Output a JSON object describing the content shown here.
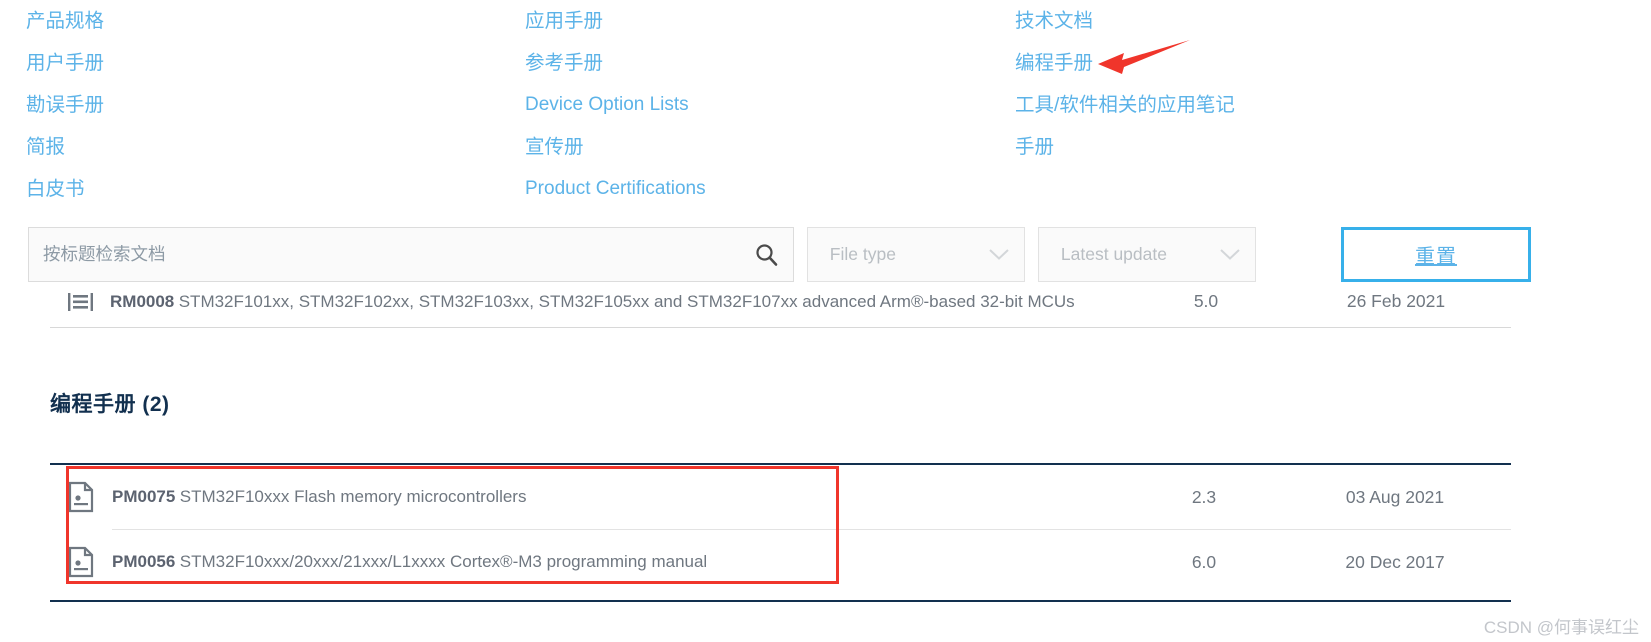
{
  "categories": {
    "column1": [
      {
        "label": "产品规格",
        "latin": false
      },
      {
        "label": "用户手册",
        "latin": false
      },
      {
        "label": "勘误手册",
        "latin": false
      },
      {
        "label": "简报",
        "latin": false
      },
      {
        "label": "白皮书",
        "latin": false
      }
    ],
    "column2": [
      {
        "label": "应用手册",
        "latin": false
      },
      {
        "label": "参考手册",
        "latin": false
      },
      {
        "label": "Device Option Lists",
        "latin": true
      },
      {
        "label": "宣传册",
        "latin": false
      },
      {
        "label": "Product Certifications",
        "latin": true
      }
    ],
    "column3": [
      {
        "label": "技术文档",
        "latin": false
      },
      {
        "label": "编程手册",
        "latin": false
      },
      {
        "label": "工具/软件相关的应用笔记",
        "latin": false
      },
      {
        "label": "手册",
        "latin": false
      }
    ]
  },
  "annotation": {
    "type": "red-arrow",
    "points_to": "编程手册",
    "color": "#f0352b"
  },
  "filter_bar": {
    "search": {
      "placeholder": "按标题检索文档",
      "value": "",
      "icon": "search-icon"
    },
    "file_type": {
      "label": "File type",
      "icon": "chevron-down-icon"
    },
    "latest_update": {
      "label": "Latest update",
      "icon": "chevron-down-icon"
    },
    "reset": {
      "label": "重置",
      "border_color": "#37b0ea",
      "text_color": "#5cb3e8"
    }
  },
  "clipped_row": {
    "id": "RM0008",
    "description": "STM32F101xx, STM32F102xx, STM32F103xx, STM32F105xx and STM32F107xx advanced Arm®-based 32-bit MCUs",
    "version": "5.0",
    "date": "26 Feb 2021",
    "icon": "document-lines-icon"
  },
  "section": {
    "heading": "编程手册 (2)",
    "count": 2
  },
  "documents": [
    {
      "id": "PM0075",
      "description": "STM32F10xxx Flash memory microcontrollers",
      "version": "2.3",
      "date": "03 Aug 2021",
      "icon": "pdf-document-icon"
    },
    {
      "id": "PM0056",
      "description": "STM32F10xxx/20xxx/21xxx/L1xxxx Cortex®-M3 programming manual",
      "version": "6.0",
      "date": "20 Dec 2017",
      "icon": "pdf-document-icon"
    }
  ],
  "colors": {
    "link_blue": "#5cb3e8",
    "heading_navy": "#12304f",
    "annotation_red": "#f0352b",
    "text_gray": "#6f7780"
  },
  "watermark": {
    "text": "CSDN @何事误红尘"
  }
}
